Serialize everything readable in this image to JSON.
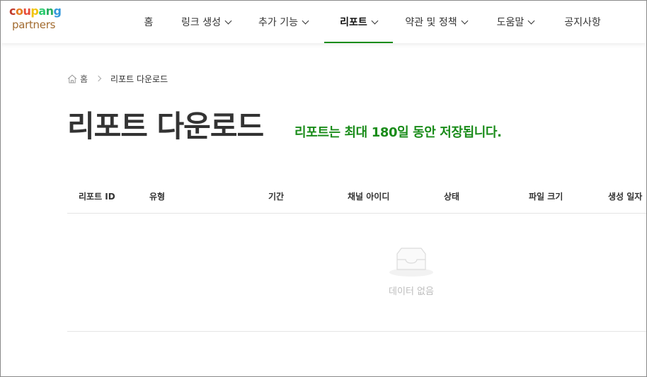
{
  "header": {
    "logo": {
      "top": "coupang",
      "bottom": "partners"
    },
    "nav": [
      {
        "label": "홈",
        "has_dropdown": false,
        "active": false
      },
      {
        "label": "링크 생성",
        "has_dropdown": true,
        "active": false
      },
      {
        "label": "추가 기능",
        "has_dropdown": true,
        "active": false
      },
      {
        "label": "리포트",
        "has_dropdown": true,
        "active": true
      },
      {
        "label": "약관 및 정책",
        "has_dropdown": true,
        "active": false
      },
      {
        "label": "도움말",
        "has_dropdown": true,
        "active": false
      },
      {
        "label": "공지사항",
        "has_dropdown": false,
        "active": false
      }
    ]
  },
  "breadcrumb": {
    "home": "홈",
    "current": "리포트 다운로드"
  },
  "page": {
    "title": "리포트 다운로드",
    "note": "리포트는 최대 180일 동안 저장됩니다."
  },
  "table": {
    "columns": [
      "리포트 ID",
      "유형",
      "기간",
      "채널 아이디",
      "상태",
      "파일 크기",
      "생성 일자"
    ],
    "empty_text": "데이터 없음"
  },
  "colors": {
    "accent": "#1a8c1a",
    "logo_partners": "#a26b2f"
  }
}
